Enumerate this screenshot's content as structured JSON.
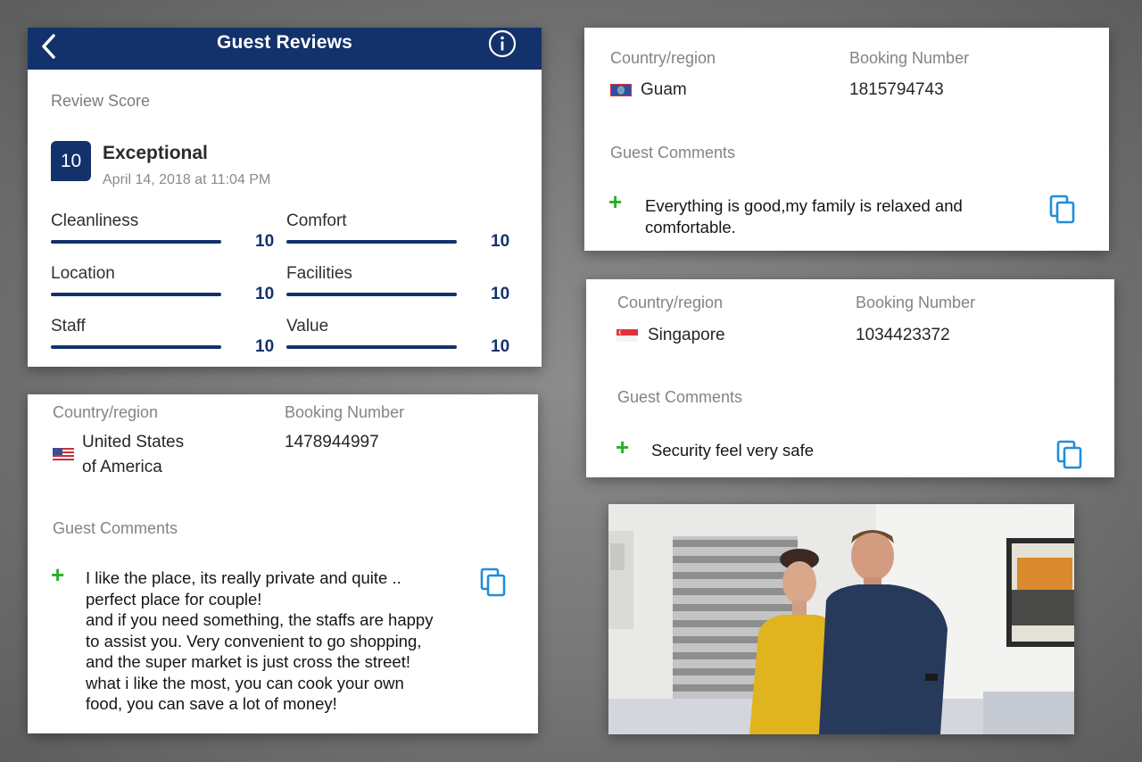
{
  "header": {
    "title": "Guest Reviews",
    "back_icon": "chevron-left-icon",
    "info_icon": "info-icon"
  },
  "review_score": {
    "label": "Review Score",
    "score": "10",
    "word": "Exceptional",
    "date": "April 14, 2018 at 11:04 PM",
    "subscores": [
      {
        "name": "Cleanliness",
        "value": "10",
        "fraction": 1.0
      },
      {
        "name": "Comfort",
        "value": "10",
        "fraction": 1.0
      },
      {
        "name": "Location",
        "value": "10",
        "fraction": 1.0
      },
      {
        "name": "Facilities",
        "value": "10",
        "fraction": 1.0
      },
      {
        "name": "Staff",
        "value": "10",
        "fraction": 1.0
      },
      {
        "name": "Value",
        "value": "10",
        "fraction": 1.0
      }
    ]
  },
  "labels": {
    "country": "Country/region",
    "booking": "Booking Number",
    "comments": "Guest Comments"
  },
  "reviews": [
    {
      "country": "United States of America",
      "country_line1": "United States",
      "country_line2": "of America",
      "flag": "us-flag-icon",
      "booking_number": "1478944997",
      "comment": "I like the place, its really private and quite ..\nperfect place for couple!\nand if you need something, the staffs are happy\nto assist you. Very convenient to go shopping,\nand the super market is just cross the street!\nwhat i like the most, you can cook your own\nfood, you can save a lot of money!"
    },
    {
      "country": "Guam",
      "flag": "guam-flag-icon",
      "booking_number": "1815794743",
      "comment": "Everything is good,my family is relaxed and\ncomfortable."
    },
    {
      "country": "Singapore",
      "flag": "singapore-flag-icon",
      "booking_number": "1034423372",
      "comment": "Security feel very safe"
    }
  ],
  "colors": {
    "brand_navy": "#13326c",
    "plus_green": "#28b028",
    "copy_blue": "#1f8fd9"
  }
}
